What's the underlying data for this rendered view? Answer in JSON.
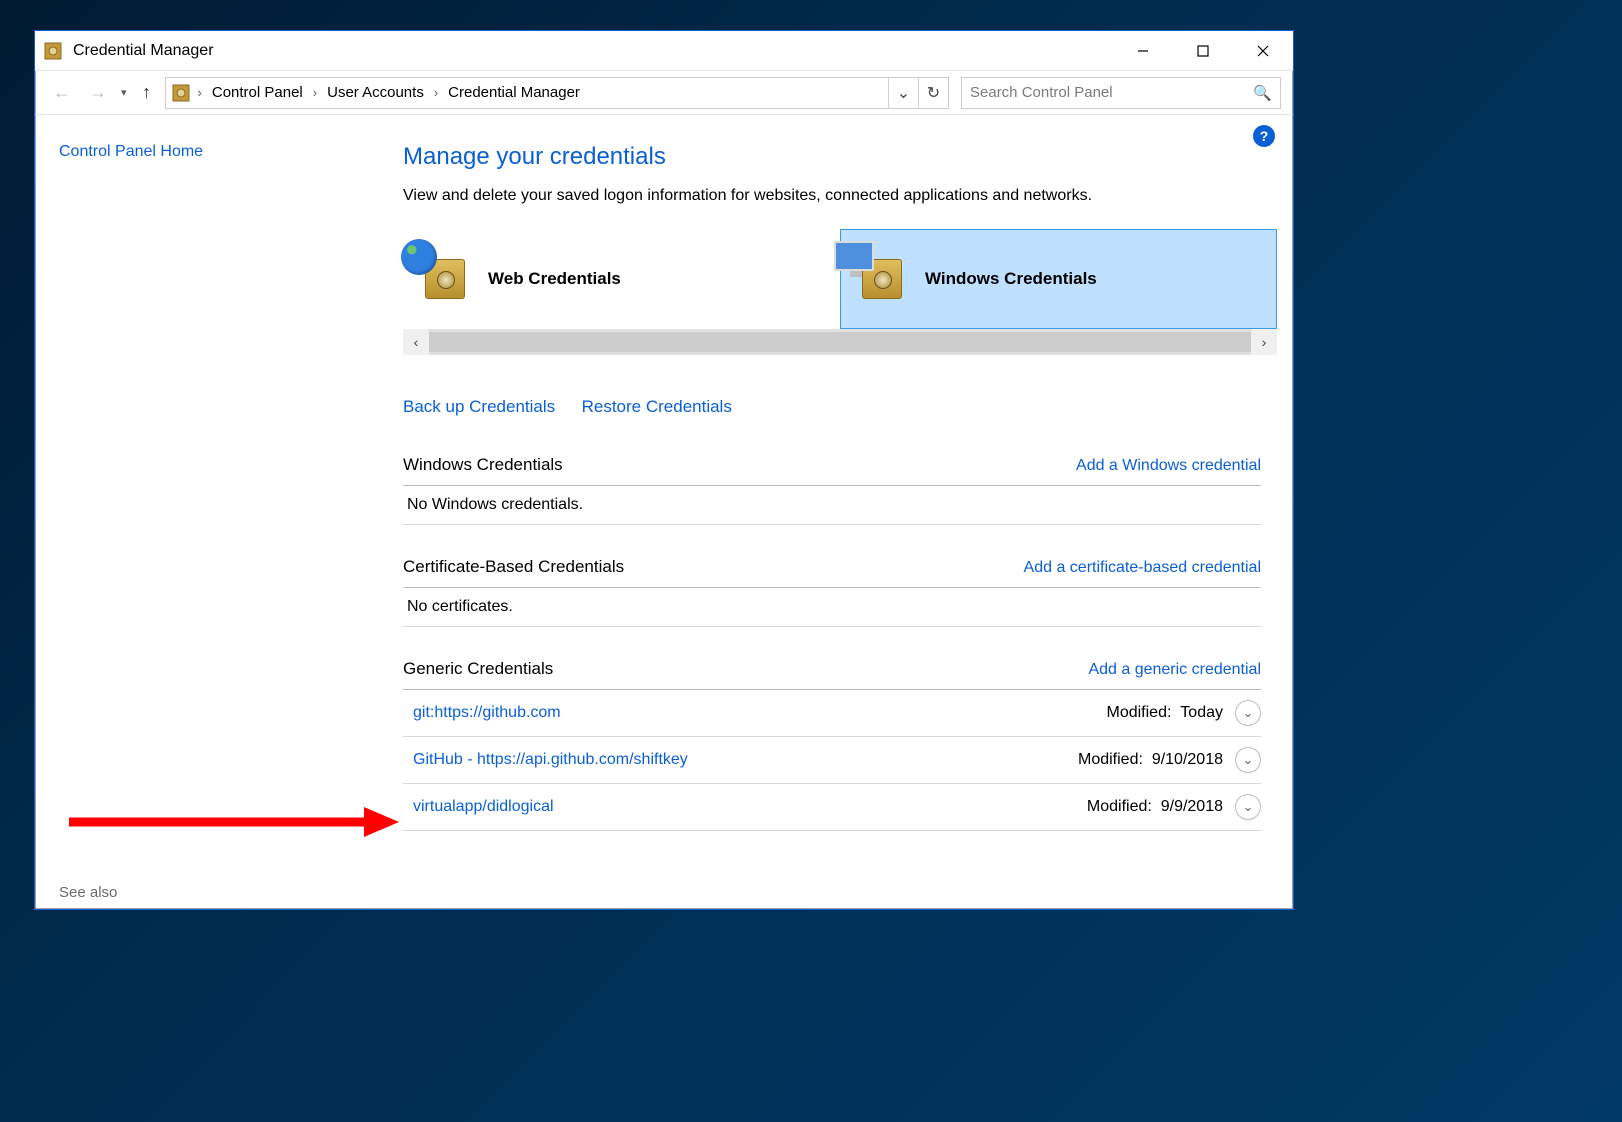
{
  "window": {
    "title": "Credential Manager"
  },
  "breadcrumb": {
    "items": [
      "Control Panel",
      "User Accounts",
      "Credential Manager"
    ]
  },
  "search": {
    "placeholder": "Search Control Panel"
  },
  "sidebar": {
    "home": "Control Panel Home",
    "seealso": "See also"
  },
  "main": {
    "heading": "Manage your credentials",
    "subtext": "View and delete your saved logon information for websites, connected applications and networks.",
    "tiles": {
      "web": "Web Credentials",
      "windows": "Windows Credentials"
    },
    "actions": {
      "backup": "Back up Credentials",
      "restore": "Restore Credentials"
    },
    "sections": [
      {
        "title": "Windows Credentials",
        "add": "Add a Windows credential",
        "empty": "No Windows credentials."
      },
      {
        "title": "Certificate-Based Credentials",
        "add": "Add a certificate-based credential",
        "empty": "No certificates."
      },
      {
        "title": "Generic Credentials",
        "add": "Add a generic credential",
        "items": [
          {
            "name": "git:https://github.com",
            "modified_label": "Modified:",
            "modified_value": "Today"
          },
          {
            "name": "GitHub - https://api.github.com/shiftkey",
            "modified_label": "Modified:",
            "modified_value": "9/10/2018"
          },
          {
            "name": "virtualapp/didlogical",
            "modified_label": "Modified:",
            "modified_value": "9/9/2018"
          }
        ]
      }
    ]
  }
}
